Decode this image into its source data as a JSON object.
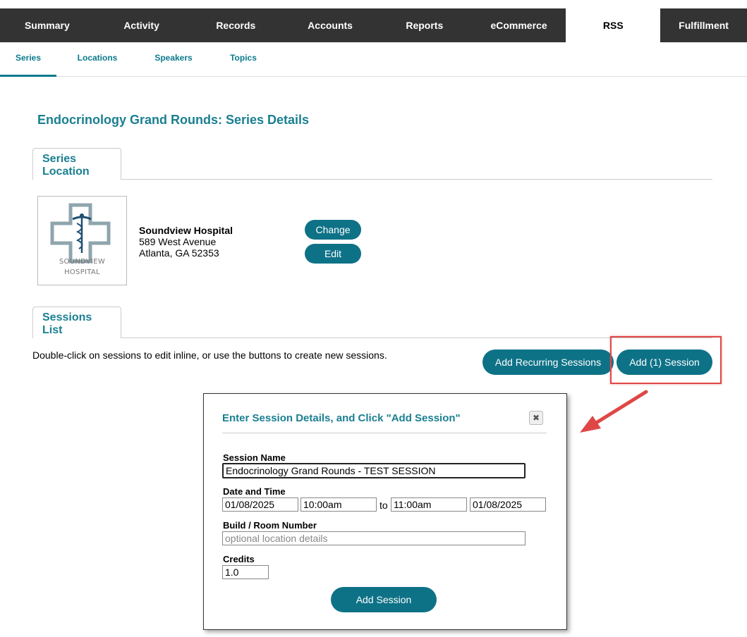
{
  "top_nav": {
    "tabs": [
      "Summary",
      "Activity",
      "Records",
      "Accounts",
      "Reports",
      "eCommerce",
      "RSS",
      "Fulfillment"
    ],
    "active": "RSS"
  },
  "sub_nav": {
    "tabs": [
      "Series",
      "Locations",
      "Speakers",
      "Topics"
    ],
    "active": "Series"
  },
  "page_title": "Endocrinology Grand Rounds: Series Details",
  "series_location": {
    "tab_label": "Series Location",
    "logo_text_line1": "SOUNDVIEW",
    "logo_text_line2": "HOSPITAL",
    "name": "Soundview Hospital",
    "address_line1": "589 West Avenue",
    "address_line2": "Atlanta, GA 52353",
    "change_label": "Change",
    "edit_label": "Edit"
  },
  "sessions_list": {
    "tab_label": "Sessions List",
    "instructions": "Double-click on sessions to edit inline, or use the buttons to create new sessions.",
    "add_recurring_label": "Add Recurring Sessions",
    "add_one_label": "Add (1) Session"
  },
  "modal": {
    "title": "Enter Session Details, and Click \"Add Session\"",
    "close_glyph": "✖",
    "session_name_label": "Session Name",
    "session_name_value": "Endocrinology Grand Rounds - TEST SESSION",
    "date_time_label": "Date and Time",
    "start_date": "01/08/2025",
    "start_time": "10:00am",
    "to_label": "to",
    "end_time": "11:00am",
    "end_date": "01/08/2025",
    "room_label": "Build / Room Number",
    "room_placeholder": "optional location details",
    "credits_label": "Credits",
    "credits_value": "1.0",
    "submit_label": "Add Session"
  },
  "colors": {
    "nav_bg": "#333333",
    "accent": "#1a7f91",
    "button": "#0e7287",
    "highlight": "#e04646"
  }
}
